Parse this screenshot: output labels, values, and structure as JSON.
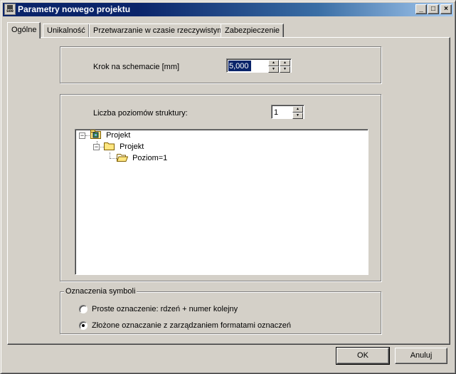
{
  "window": {
    "title": "Parametry nowego projektu",
    "app_icon_text": "see",
    "minimize": "_",
    "maximize": "□",
    "close": "×"
  },
  "tabs": [
    {
      "label": "Ogólne",
      "active": true
    },
    {
      "label": "Unikalność",
      "active": false
    },
    {
      "label": "Przetwarzanie w czasie rzeczywistym",
      "active": false
    },
    {
      "label": "Zabezpieczenie",
      "active": false
    }
  ],
  "grid_step": {
    "label": "Krok na schemacie [mm]",
    "value": "5,000"
  },
  "structure": {
    "label": "Liczba poziomów struktury:",
    "value": "1",
    "tree": [
      {
        "label": "Projekt",
        "icon": "project-root-icon"
      },
      {
        "label": "Projekt",
        "icon": "folder-icon"
      },
      {
        "label": "Poziom=1",
        "icon": "open-folder-icon"
      }
    ]
  },
  "symbols": {
    "legend": "Oznaczenia symboli",
    "options": [
      {
        "label": "Proste oznaczenie: rdzeń + numer kolejny",
        "selected": false
      },
      {
        "label": "Złożone oznaczanie z zarządzaniem formatami oznaczeń",
        "selected": true
      }
    ]
  },
  "buttons": {
    "ok": "OK",
    "cancel": "Anuluj"
  },
  "colors": {
    "titlebar": "#0a246a",
    "face": "#d4d0c8",
    "folder": "#ffe680"
  }
}
